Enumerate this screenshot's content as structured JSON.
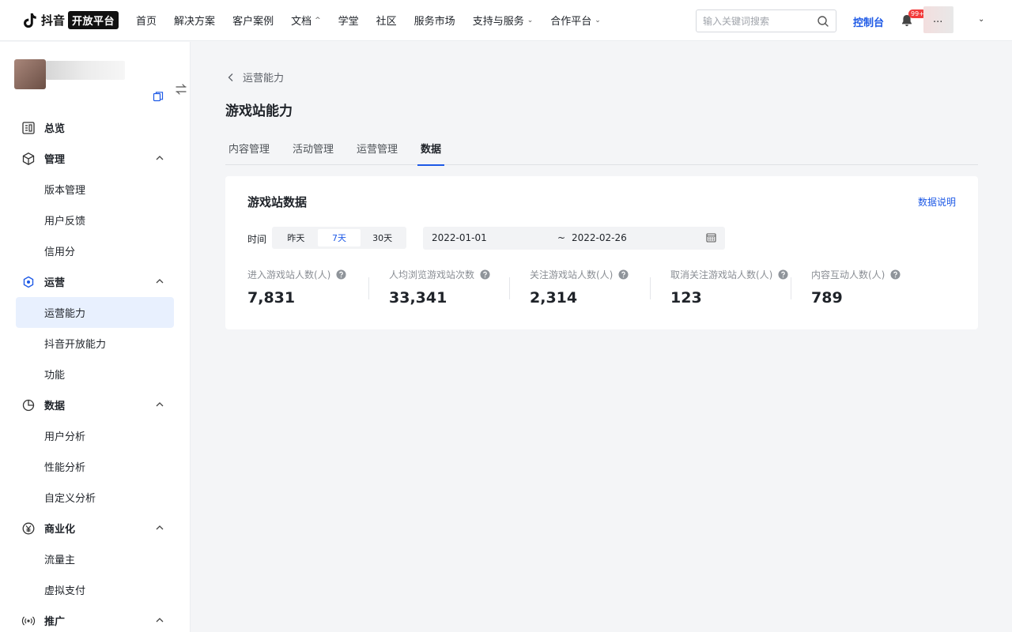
{
  "topbar": {
    "logo_name": "抖音",
    "logo_tag": "开放平台",
    "nav": [
      {
        "label": "首页",
        "has_caret": false
      },
      {
        "label": "解决方案",
        "has_caret": false
      },
      {
        "label": "客户案例",
        "has_caret": false
      },
      {
        "label": "文档",
        "has_caret": true
      },
      {
        "label": "学堂",
        "has_caret": false
      },
      {
        "label": "社区",
        "has_caret": false
      },
      {
        "label": "服务市场",
        "has_caret": false
      },
      {
        "label": "支持与服务",
        "has_caret": true
      },
      {
        "label": "合作平台",
        "has_caret": true
      }
    ],
    "search_placeholder": "输入关键词搜索",
    "console": "控制台",
    "notification_badge": "99+",
    "user_name": "..."
  },
  "sidebar": {
    "groups": [
      {
        "label": "总览",
        "icon": "overview-icon",
        "items": []
      },
      {
        "label": "管理",
        "icon": "cube-icon",
        "items": [
          "版本管理",
          "用户反馈",
          "信用分"
        ]
      },
      {
        "label": "运营",
        "icon": "operation-icon",
        "items": [
          "运营能力",
          "抖音开放能力",
          "功能"
        ]
      },
      {
        "label": "数据",
        "icon": "pie-chart-icon",
        "items": [
          "用户分析",
          "性能分析",
          "自定义分析"
        ]
      },
      {
        "label": "商业化",
        "icon": "yen-icon",
        "items": [
          "流量主",
          "虚拟支付"
        ]
      },
      {
        "label": "推广",
        "icon": "broadcast-icon",
        "items": []
      }
    ],
    "active_item": "运营能力"
  },
  "main": {
    "back_label": "运营能力",
    "page_title": "游戏站能力",
    "tabs": [
      "内容管理",
      "活动管理",
      "运营管理",
      "数据"
    ],
    "active_tab": "数据",
    "card": {
      "title": "游戏站数据",
      "link": "数据说明",
      "time_label": "时间",
      "ranges": [
        "昨天",
        "7天",
        "30天"
      ],
      "active_range": "7天",
      "date_start": "2022-01-01",
      "date_sep": "~",
      "date_end": "2022-02-26",
      "stats": [
        {
          "label": "进入游戏站人数(人)",
          "value": "7,831"
        },
        {
          "label": "人均浏览游戏站次数",
          "value": "33,341"
        },
        {
          "label": "关注游戏站人数(人)",
          "value": "2,314"
        },
        {
          "label": "取消关注游戏站人数(人)",
          "value": "123"
        },
        {
          "label": "内容互动人数(人)",
          "value": "789"
        }
      ]
    }
  },
  "colors": {
    "accent": "#1d59e6",
    "badge": "#f23c3c",
    "active_menu_bg": "#e8f0fe",
    "page_bg": "#f4f5f7"
  }
}
